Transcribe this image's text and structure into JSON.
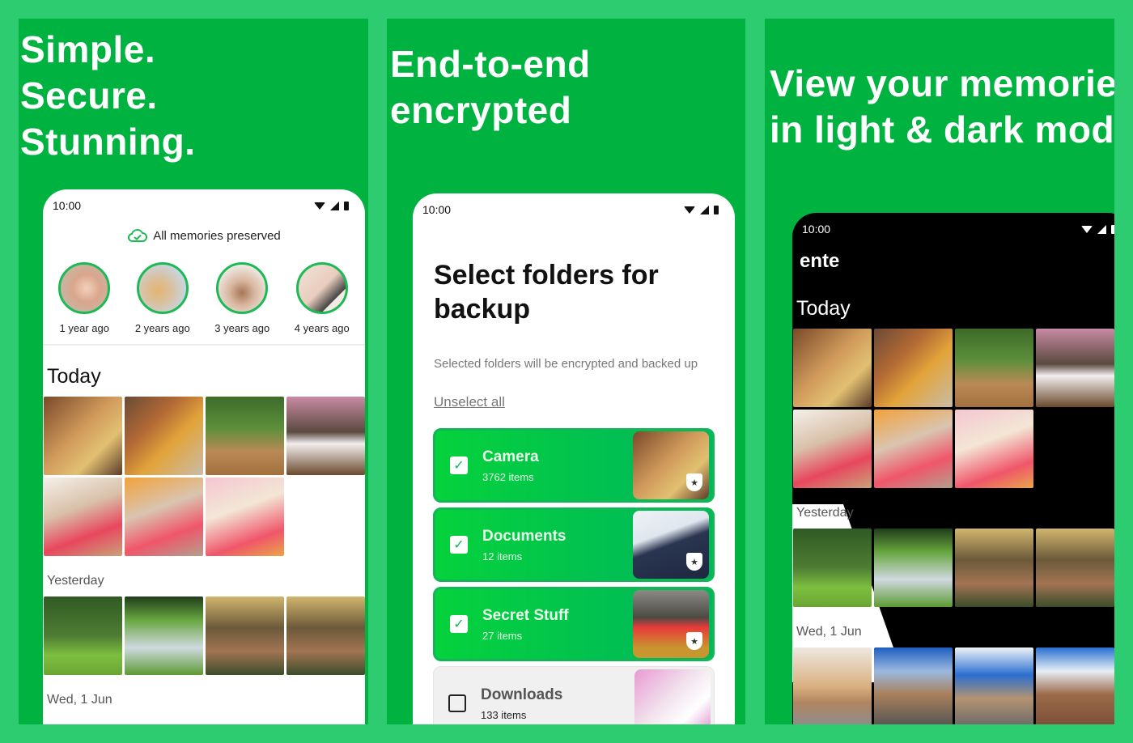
{
  "colors": {
    "page_bg": "#2ecc71",
    "panel_bg": "#00b341",
    "accent": "#1db954"
  },
  "panels": [
    {
      "headline_lines": [
        "Simple.",
        "Secure.",
        "Stunning."
      ],
      "phone": {
        "time": "10:00",
        "status_icons": [
          "wifi-icon",
          "signal-icon",
          "battery-icon"
        ],
        "banner_icon": "cloud-check-icon",
        "banner": "All memories preserved",
        "memories": [
          {
            "label": "1 year ago",
            "image": "baby"
          },
          {
            "label": "2 years ago",
            "image": "puppy"
          },
          {
            "label": "3 years ago",
            "image": "house-keys"
          },
          {
            "label": "4 years ago",
            "image": "holding-hands"
          }
        ],
        "sections": [
          {
            "title": "Today",
            "photos": [
              "friends-group",
              "woman-laughing",
              "garden-party",
              "birthday-cake",
              "toddler-crawling",
              "toddler-balloons",
              "toddler-pink-balloon"
            ]
          },
          {
            "title": "Yesterday",
            "photos": [
              "mother-child-park",
              "toddler-meadow",
              "couple-walking",
              "couple-walking-2"
            ]
          },
          {
            "title": "Wed, 1 Jun",
            "photos": []
          }
        ]
      }
    },
    {
      "headline_lines": [
        "End-to-end",
        "encrypted"
      ],
      "phone": {
        "time": "10:00",
        "title": "Select folders for backup",
        "description": "Selected folders will be encrypted and backed up",
        "unselect_all": "Unselect all",
        "folders": [
          {
            "name": "Camera",
            "count": "3762 items",
            "checked": true,
            "image": "friends-group"
          },
          {
            "name": "Documents",
            "count": "12 items",
            "checked": true,
            "image": "passport"
          },
          {
            "name": "Secret Stuff",
            "count": "27 items",
            "checked": true,
            "image": "couple-heart-balloon"
          },
          {
            "name": "Downloads",
            "count": "133 items",
            "checked": false,
            "image": "cat-sunglasses"
          }
        ]
      }
    },
    {
      "headline_lines": [
        "View your memories",
        "in light & dark mode"
      ],
      "phone": {
        "time": "10:00",
        "app_name": "ente",
        "sections": [
          {
            "title": "Today",
            "photos": [
              "friends-group",
              "woman-laughing",
              "garden-party",
              "birthday-cake",
              "toddler-crawling",
              "toddler-balloons",
              "toddler-pink-balloon"
            ]
          },
          {
            "title": "Yesterday",
            "photos": [
              "mother-child-park",
              "toddler-meadow",
              "couple-walking",
              "couple-walking-2"
            ]
          },
          {
            "title": "Wed, 1 Jun",
            "photos": [
              "desert-road-biker",
              "mountain-road-cyclists",
              "cyclist-blue-sky",
              "cyclist-mountains"
            ]
          }
        ]
      }
    }
  ]
}
